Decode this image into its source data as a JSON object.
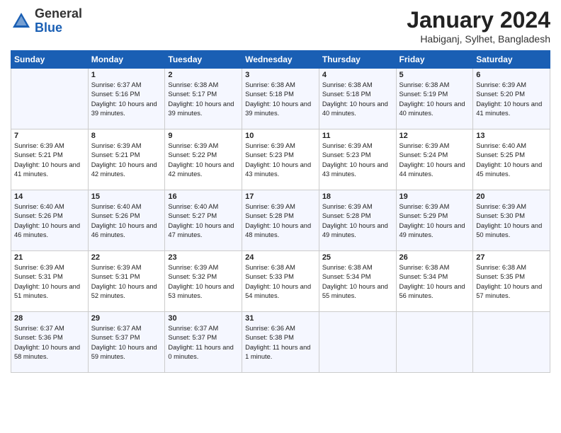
{
  "header": {
    "logo_general": "General",
    "logo_blue": "Blue",
    "month_title": "January 2024",
    "location": "Habiganj, Sylhet, Bangladesh"
  },
  "days_of_week": [
    "Sunday",
    "Monday",
    "Tuesday",
    "Wednesday",
    "Thursday",
    "Friday",
    "Saturday"
  ],
  "weeks": [
    [
      {
        "num": "",
        "info": ""
      },
      {
        "num": "1",
        "info": "Sunrise: 6:37 AM\nSunset: 5:16 PM\nDaylight: 10 hours\nand 39 minutes."
      },
      {
        "num": "2",
        "info": "Sunrise: 6:38 AM\nSunset: 5:17 PM\nDaylight: 10 hours\nand 39 minutes."
      },
      {
        "num": "3",
        "info": "Sunrise: 6:38 AM\nSunset: 5:18 PM\nDaylight: 10 hours\nand 39 minutes."
      },
      {
        "num": "4",
        "info": "Sunrise: 6:38 AM\nSunset: 5:18 PM\nDaylight: 10 hours\nand 40 minutes."
      },
      {
        "num": "5",
        "info": "Sunrise: 6:38 AM\nSunset: 5:19 PM\nDaylight: 10 hours\nand 40 minutes."
      },
      {
        "num": "6",
        "info": "Sunrise: 6:39 AM\nSunset: 5:20 PM\nDaylight: 10 hours\nand 41 minutes."
      }
    ],
    [
      {
        "num": "7",
        "info": "Sunrise: 6:39 AM\nSunset: 5:21 PM\nDaylight: 10 hours\nand 41 minutes."
      },
      {
        "num": "8",
        "info": "Sunrise: 6:39 AM\nSunset: 5:21 PM\nDaylight: 10 hours\nand 42 minutes."
      },
      {
        "num": "9",
        "info": "Sunrise: 6:39 AM\nSunset: 5:22 PM\nDaylight: 10 hours\nand 42 minutes."
      },
      {
        "num": "10",
        "info": "Sunrise: 6:39 AM\nSunset: 5:23 PM\nDaylight: 10 hours\nand 43 minutes."
      },
      {
        "num": "11",
        "info": "Sunrise: 6:39 AM\nSunset: 5:23 PM\nDaylight: 10 hours\nand 43 minutes."
      },
      {
        "num": "12",
        "info": "Sunrise: 6:39 AM\nSunset: 5:24 PM\nDaylight: 10 hours\nand 44 minutes."
      },
      {
        "num": "13",
        "info": "Sunrise: 6:40 AM\nSunset: 5:25 PM\nDaylight: 10 hours\nand 45 minutes."
      }
    ],
    [
      {
        "num": "14",
        "info": "Sunrise: 6:40 AM\nSunset: 5:26 PM\nDaylight: 10 hours\nand 46 minutes."
      },
      {
        "num": "15",
        "info": "Sunrise: 6:40 AM\nSunset: 5:26 PM\nDaylight: 10 hours\nand 46 minutes."
      },
      {
        "num": "16",
        "info": "Sunrise: 6:40 AM\nSunset: 5:27 PM\nDaylight: 10 hours\nand 47 minutes."
      },
      {
        "num": "17",
        "info": "Sunrise: 6:39 AM\nSunset: 5:28 PM\nDaylight: 10 hours\nand 48 minutes."
      },
      {
        "num": "18",
        "info": "Sunrise: 6:39 AM\nSunset: 5:28 PM\nDaylight: 10 hours\nand 49 minutes."
      },
      {
        "num": "19",
        "info": "Sunrise: 6:39 AM\nSunset: 5:29 PM\nDaylight: 10 hours\nand 49 minutes."
      },
      {
        "num": "20",
        "info": "Sunrise: 6:39 AM\nSunset: 5:30 PM\nDaylight: 10 hours\nand 50 minutes."
      }
    ],
    [
      {
        "num": "21",
        "info": "Sunrise: 6:39 AM\nSunset: 5:31 PM\nDaylight: 10 hours\nand 51 minutes."
      },
      {
        "num": "22",
        "info": "Sunrise: 6:39 AM\nSunset: 5:31 PM\nDaylight: 10 hours\nand 52 minutes."
      },
      {
        "num": "23",
        "info": "Sunrise: 6:39 AM\nSunset: 5:32 PM\nDaylight: 10 hours\nand 53 minutes."
      },
      {
        "num": "24",
        "info": "Sunrise: 6:38 AM\nSunset: 5:33 PM\nDaylight: 10 hours\nand 54 minutes."
      },
      {
        "num": "25",
        "info": "Sunrise: 6:38 AM\nSunset: 5:34 PM\nDaylight: 10 hours\nand 55 minutes."
      },
      {
        "num": "26",
        "info": "Sunrise: 6:38 AM\nSunset: 5:34 PM\nDaylight: 10 hours\nand 56 minutes."
      },
      {
        "num": "27",
        "info": "Sunrise: 6:38 AM\nSunset: 5:35 PM\nDaylight: 10 hours\nand 57 minutes."
      }
    ],
    [
      {
        "num": "28",
        "info": "Sunrise: 6:37 AM\nSunset: 5:36 PM\nDaylight: 10 hours\nand 58 minutes."
      },
      {
        "num": "29",
        "info": "Sunrise: 6:37 AM\nSunset: 5:37 PM\nDaylight: 10 hours\nand 59 minutes."
      },
      {
        "num": "30",
        "info": "Sunrise: 6:37 AM\nSunset: 5:37 PM\nDaylight: 11 hours\nand 0 minutes."
      },
      {
        "num": "31",
        "info": "Sunrise: 6:36 AM\nSunset: 5:38 PM\nDaylight: 11 hours\nand 1 minute."
      },
      {
        "num": "",
        "info": ""
      },
      {
        "num": "",
        "info": ""
      },
      {
        "num": "",
        "info": ""
      }
    ]
  ]
}
